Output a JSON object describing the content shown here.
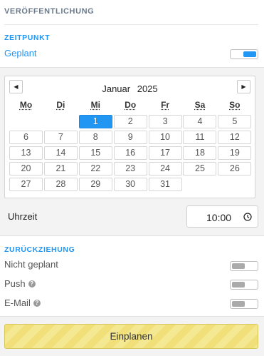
{
  "header": {
    "title": "VERÖFFENTLICHUNG"
  },
  "zeitpunkt": {
    "section_label": "ZEITPUNKT",
    "option_label": "Geplant",
    "toggle_on": true
  },
  "calendar": {
    "prev_symbol": "◀",
    "next_symbol": "▶",
    "month": "Januar",
    "year": "2025",
    "weekdays": [
      "Mo",
      "Di",
      "Mi",
      "Do",
      "Fr",
      "Sa",
      "So"
    ],
    "leading_blanks": 2,
    "days": [
      "1",
      "2",
      "3",
      "4",
      "5",
      "6",
      "7",
      "8",
      "9",
      "10",
      "11",
      "12",
      "13",
      "14",
      "15",
      "16",
      "17",
      "18",
      "19",
      "20",
      "21",
      "22",
      "23",
      "24",
      "25",
      "26",
      "27",
      "28",
      "29",
      "30",
      "31"
    ],
    "selected_day": "1"
  },
  "time": {
    "label": "Uhrzeit",
    "value": "10:00"
  },
  "zurueckziehung": {
    "section_label": "ZURÜCKZIEHUNG",
    "not_planned_label": "Nicht geplant",
    "push_label": "Push",
    "email_label": "E-Mail",
    "help_symbol": "?",
    "not_planned_on": false,
    "push_on": false,
    "email_on": false
  },
  "footer": {
    "schedule_button": "Einplanen"
  },
  "colors": {
    "accent": "#2196f3",
    "button_yellow": "#f1e07a"
  }
}
